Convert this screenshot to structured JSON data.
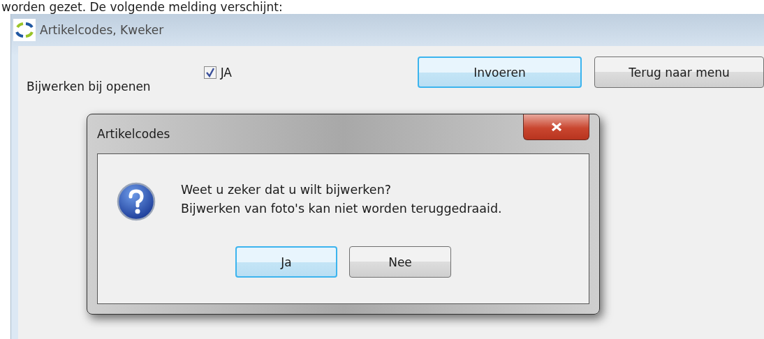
{
  "caption": "worden gezet. De volgende melding verschijnt:",
  "window": {
    "title": "Artikelcodes, Kweker"
  },
  "form": {
    "label": "Bijwerken bij openen",
    "checkbox": {
      "label": "JA",
      "checked": true
    }
  },
  "buttons": [
    {
      "label": "Invoeren",
      "default": true
    },
    {
      "label": "Terug naar menu",
      "default": false
    }
  ],
  "dialog": {
    "title": "Artikelcodes",
    "message": [
      "Weet u zeker dat u wilt bijwerken?",
      "Bijwerken van foto's kan niet worden teruggedraaid."
    ],
    "buttons": [
      {
        "label": "Ja",
        "default": true
      },
      {
        "label": "Nee",
        "default": false
      }
    ]
  }
}
